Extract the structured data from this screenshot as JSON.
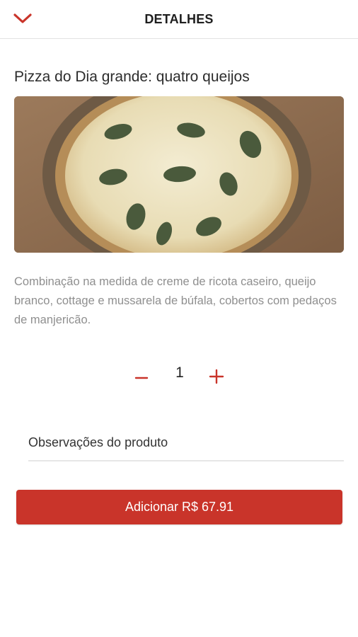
{
  "header": {
    "title": "DETALHES",
    "back_icon": "chevron-down-icon"
  },
  "product": {
    "title": "Pizza do Dia grande: quatro queijos",
    "image_alt": "pizza",
    "description": "Combinação na medida de creme de ricota caseiro, queijo branco, cottage e mussarela de búfala, cobertos com pedaços de manjericão."
  },
  "quantity": {
    "value": "1",
    "minus_icon": "minus-icon",
    "plus_icon": "plus-icon"
  },
  "notes": {
    "placeholder": "Observações do produto",
    "value": ""
  },
  "add_button": {
    "label": "Adicionar R$ 67.91"
  },
  "colors": {
    "accent": "#c9342a",
    "divider": "#e2e2e2",
    "description_text": "#8f8f8f"
  }
}
